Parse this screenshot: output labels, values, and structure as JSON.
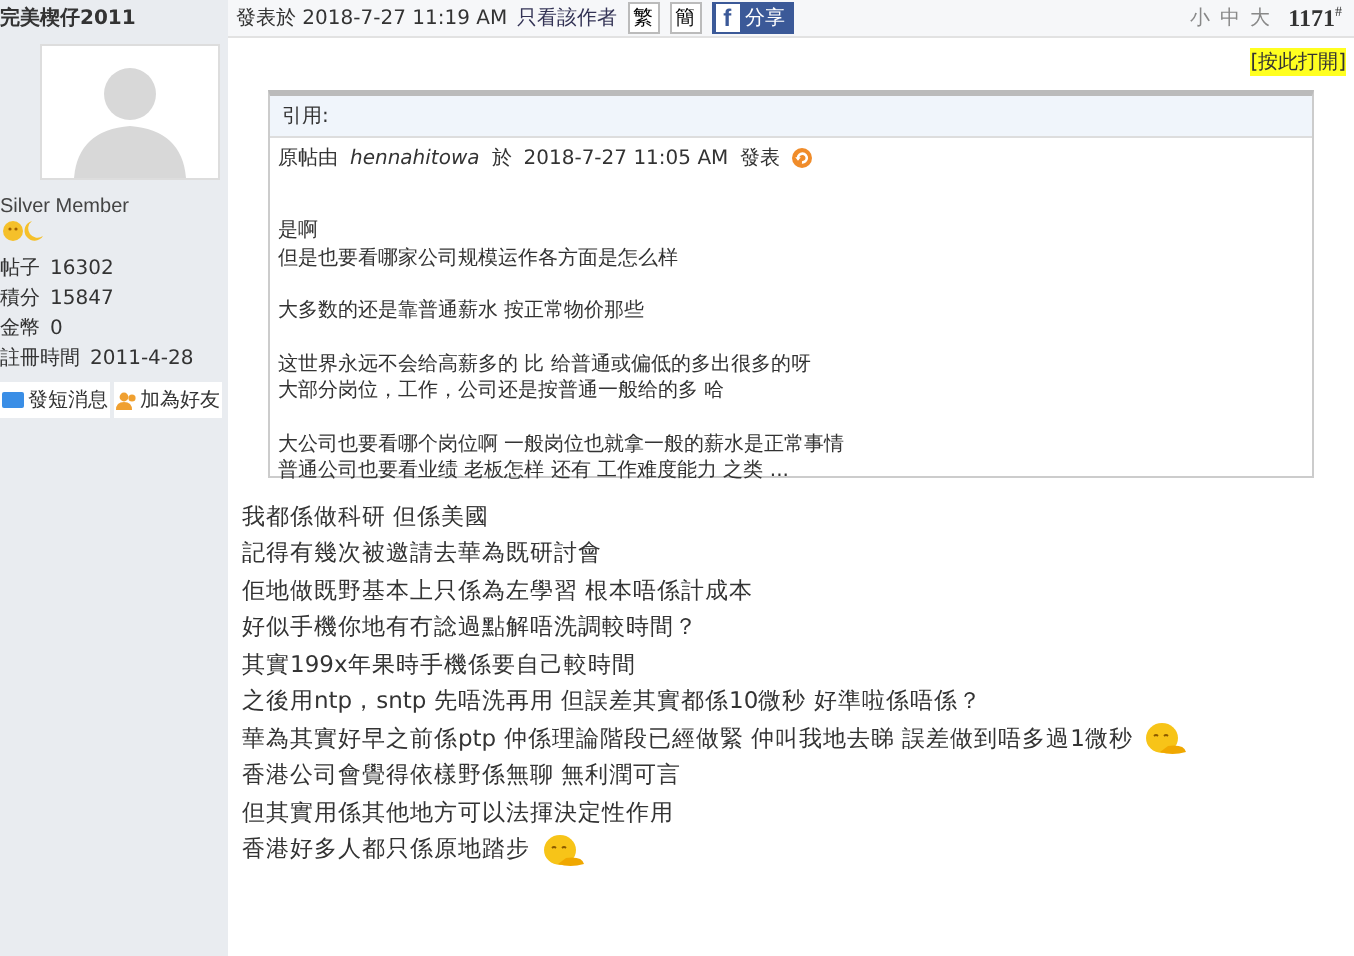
{
  "author": {
    "name": "完美楔仔2011",
    "rank": "Silver Member",
    "stats": [
      {
        "label": "帖子",
        "value": "16302"
      },
      {
        "label": "積分",
        "value": "15847"
      },
      {
        "label": "金幣",
        "value": "0"
      },
      {
        "label": "註冊時間",
        "value": "2011-4-28"
      }
    ],
    "buttons": [
      {
        "kind": "message",
        "label": "發短消息"
      },
      {
        "kind": "friend",
        "label": "加為好友"
      }
    ]
  },
  "header": {
    "posted": "發表於 2018-7-27 11:19 AM",
    "author_only": "只看該作者",
    "script_buttons": [
      "繁",
      "簡"
    ],
    "share": "分享",
    "share_mark": "f",
    "font_sizes": [
      "小",
      "中",
      "大"
    ],
    "floor": "1171",
    "floor_mark": "#"
  },
  "open_link": "[按此打開]",
  "quote": {
    "title": "引用:",
    "by": "原帖由",
    "user": "hennahitowa",
    "at": "於",
    "time": "2018-7-27  11:05  AM",
    "posted": "發表",
    "paragraphs": [
      [
        "是啊",
        "但是也要看哪家公司规模运作各方面是怎么样"
      ],
      [
        "大多数的还是靠普通薪水  按正常物价那些"
      ],
      [
        "这世界永远不会给高薪多的  比  给普通或偏低的多出很多的呀",
        "大部分岗位，工作，公司还是按普通一般给的多  哈"
      ],
      [
        "大公司也要看哪个岗位啊  一般岗位也就拿一般的薪水是正常事情",
        "普通公司也要看业绩  老板怎样  还有  工作难度能力  之类  ..."
      ]
    ]
  },
  "lines": [
    {
      "text": "我都係做科研  但係美國",
      "emoticon": false
    },
    {
      "text": "記得有幾次被邀請去華為既研討會",
      "emoticon": false
    },
    {
      "text": "佢地做既野基本上只係為左學習  根本唔係計成本",
      "emoticon": false
    },
    {
      "text": "好似手機你地有冇諗過點解唔洗調較時間？",
      "emoticon": false
    },
    {
      "text": "其實199x年果時手機係要自己較時間",
      "emoticon": false
    },
    {
      "text": "之後用ntp，sntp  先唔洗再用  但誤差其實都係10微秒  好準啦係唔係？",
      "emoticon": false
    },
    {
      "text": "華為其實好早之前係ptp  仲係理論階段已經做緊  仲叫我地去睇  誤差做到唔多過1微秒",
      "emoticon": true
    },
    {
      "text": "香港公司會覺得依樣野係無聊  無利潤可言",
      "emoticon": false
    },
    {
      "text": "但其實用係其他地方可以法揮決定性作用",
      "emoticon": false
    },
    {
      "text": "香港好多人都只係原地踏步",
      "emoticon": true
    }
  ]
}
